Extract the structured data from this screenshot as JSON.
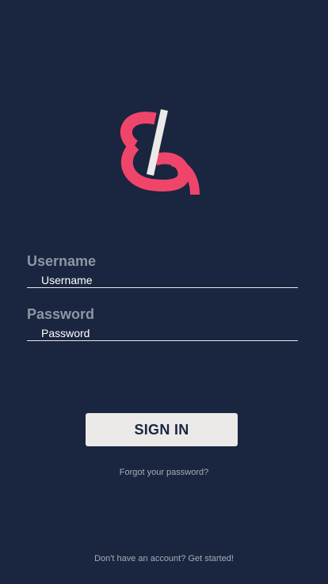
{
  "colors": {
    "background": "#1a2540",
    "accent": "#f0456a",
    "button": "#ebeae8"
  },
  "logo": {
    "icon": "brand-logo-icon"
  },
  "username": {
    "label": "Username",
    "placeholder": "Username",
    "value": ""
  },
  "password": {
    "label": "Password",
    "placeholder": "Password",
    "value": ""
  },
  "signin_label": "SIGN IN",
  "forgot_password": "Forgot your password?",
  "signup_prompt": "Don't have an account? Get started!"
}
